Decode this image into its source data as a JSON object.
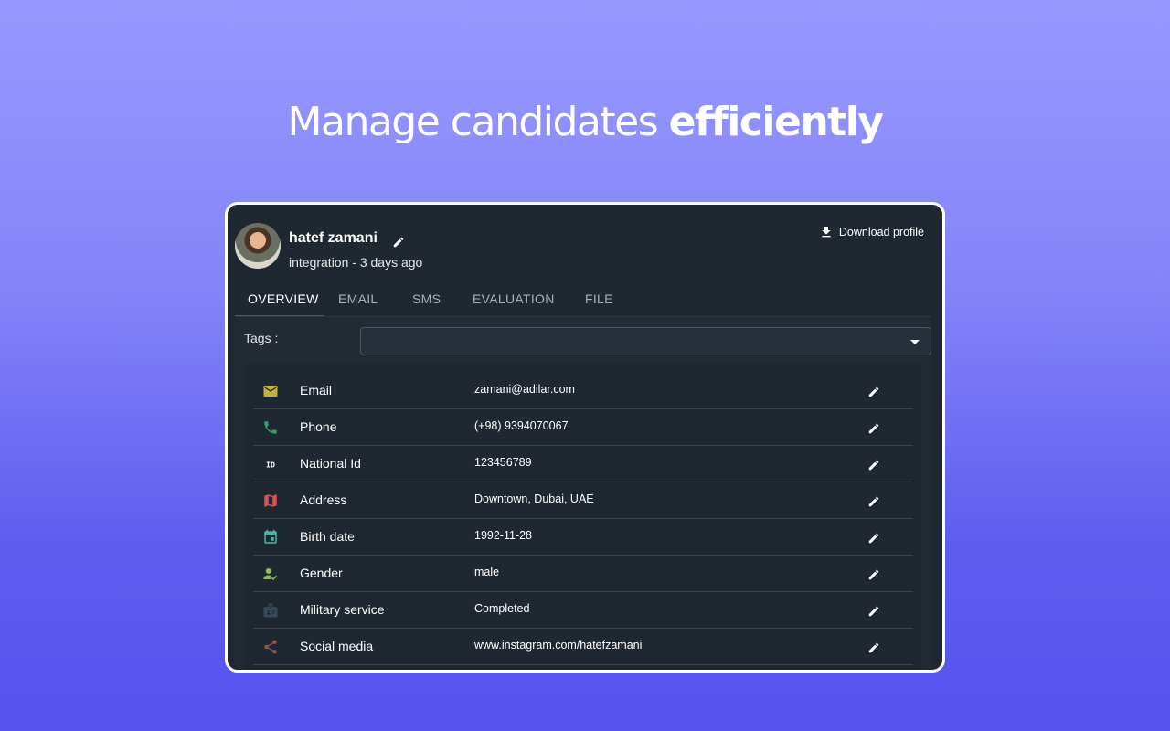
{
  "headline": {
    "normal": "Manage candidates ",
    "bold": "efficiently"
  },
  "profile": {
    "name": "hatef zamani",
    "subtitle": "integration - 3 days ago",
    "download_label": "Download profile"
  },
  "tabs": [
    {
      "label": "OVERVIEW",
      "active": true
    },
    {
      "label": "EMAIL",
      "active": false
    },
    {
      "label": "SMS",
      "active": false
    },
    {
      "label": "EVALUATION",
      "active": false
    },
    {
      "label": "FILE",
      "active": false
    }
  ],
  "tags": {
    "label": "Tags :",
    "value": ""
  },
  "fields": [
    {
      "label": "Email",
      "value": "zamani@adilar.com",
      "icon": "mail-icon",
      "color": "#c9b23a"
    },
    {
      "label": "Phone",
      "value": "(+98) 9394070067",
      "icon": "phone-icon",
      "color": "#2ea36a"
    },
    {
      "label": "National Id",
      "value": "123456789",
      "icon": "id-icon",
      "color": "#ffffff"
    },
    {
      "label": "Address",
      "value": "Downtown, Dubai, UAE",
      "icon": "map-icon",
      "color": "#e0505a"
    },
    {
      "label": "Birth date",
      "value": "1992-11-28",
      "icon": "calendar-icon",
      "color": "#3fb8a6"
    },
    {
      "label": "Gender",
      "value": "male",
      "icon": "person-check-icon",
      "color": "#8bc34a"
    },
    {
      "label": "Military service",
      "value": "Completed",
      "icon": "badge-card-icon",
      "color": "#3a4a5c"
    },
    {
      "label": "Social media",
      "value": "www.instagram.com/hatefzamani",
      "icon": "share-icon",
      "color": "#8d5a4a"
    }
  ]
}
